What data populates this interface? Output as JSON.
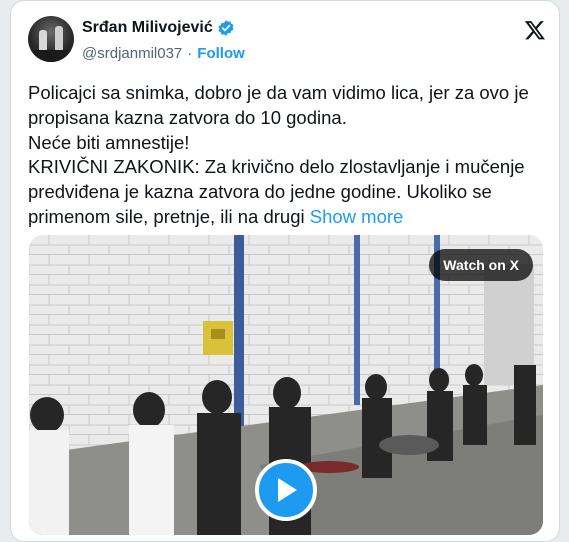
{
  "author": {
    "name": "Srđan Milivojević",
    "handle": "@srdjanmil037",
    "separator": "·",
    "follow_label": "Follow",
    "verified": true
  },
  "tweet": {
    "lines": [
      "Policajci sa snimka, dobro je da vam vidimo lica, jer za ovo je propisana kazna zatvora do 10 godina.",
      "Neće biti amnestije!",
      "KRIVIČNI ZAKONIK: Za krivično delo zlostavljanje i mučenje predviđena je kazna zatvora do jedne godine. Ukoliko se primenom sile, pretnje, ili na drugi"
    ],
    "show_more_label": "Show more"
  },
  "media": {
    "watch_label": "Watch on X",
    "play_icon": "play-icon"
  },
  "colors": {
    "accent": "#1d9bf0",
    "text": "#0f1419",
    "muted": "#536471"
  }
}
